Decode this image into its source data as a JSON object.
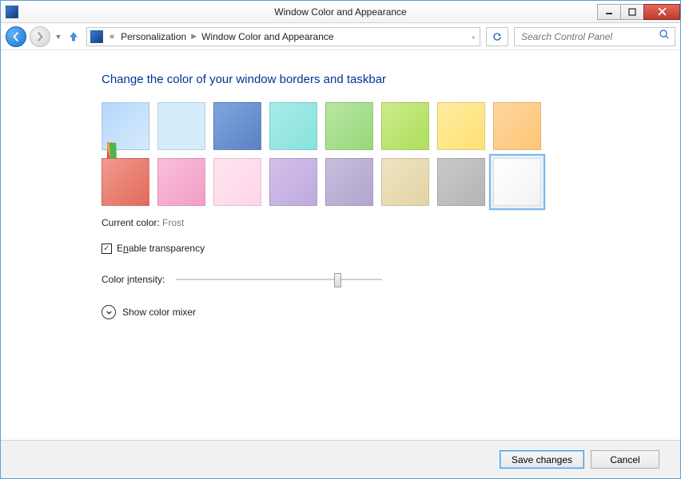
{
  "window": {
    "title": "Window Color and Appearance"
  },
  "breadcrumb": {
    "prefix": "«",
    "item1": "Personalization",
    "item2": "Window Color and Appearance"
  },
  "search": {
    "placeholder": "Search Control Panel"
  },
  "main": {
    "heading": "Change the color of your window borders and taskbar",
    "swatches": [
      {
        "name": "custom",
        "color": "custom",
        "selected": false
      },
      {
        "name": "sky",
        "color": "#d4ecfb",
        "selected": false
      },
      {
        "name": "blue",
        "color": "linear-gradient(135deg,#7ea6dd,#5a82c4)",
        "selected": false
      },
      {
        "name": "teal",
        "color": "linear-gradient(135deg,#a7ecea,#87e2dc)",
        "selected": false
      },
      {
        "name": "green",
        "color": "linear-gradient(135deg,#b8e6a1,#97d87b)",
        "selected": false
      },
      {
        "name": "lime",
        "color": "linear-gradient(135deg,#cceb8a,#addf5d)",
        "selected": false
      },
      {
        "name": "yellow",
        "color": "linear-gradient(135deg,#ffeca0,#ffe076)",
        "selected": false
      },
      {
        "name": "orange",
        "color": "linear-gradient(135deg,#ffd6a0,#ffc576)",
        "selected": false
      },
      {
        "name": "red",
        "color": "linear-gradient(135deg,#ef9a90,#e46a5a)",
        "selected": false
      },
      {
        "name": "pink",
        "color": "linear-gradient(135deg,#f7bfda,#f29dc6)",
        "selected": false
      },
      {
        "name": "blush",
        "color": "linear-gradient(135deg,#ffe6f1,#ffd4e7)",
        "selected": false
      },
      {
        "name": "purple",
        "color": "linear-gradient(135deg,#d3c1ea,#bfa8e0)",
        "selected": false
      },
      {
        "name": "violet",
        "color": "linear-gradient(135deg,#c8bedd,#b3a5cf)",
        "selected": false
      },
      {
        "name": "tan",
        "color": "linear-gradient(135deg,#eee4c3,#e2d4a4)",
        "selected": false
      },
      {
        "name": "gray",
        "color": "linear-gradient(135deg,#c9c9c9,#b5b5b5)",
        "selected": false
      },
      {
        "name": "frost",
        "color": "linear-gradient(135deg,#ffffff,#f3f3f3)",
        "selected": true
      }
    ],
    "current_label": "Current color:",
    "current_value": "Frost",
    "transparency": {
      "label_pre": "E",
      "label_u": "n",
      "label_post": "able transparency",
      "checked": true
    },
    "intensity": {
      "label_pre": "Color ",
      "label_u": "i",
      "label_post": "ntensity:",
      "value_pct": 79
    },
    "mixer": {
      "label": "Show color mixer"
    }
  },
  "footer": {
    "save": "Save changes",
    "cancel": "Cancel"
  }
}
